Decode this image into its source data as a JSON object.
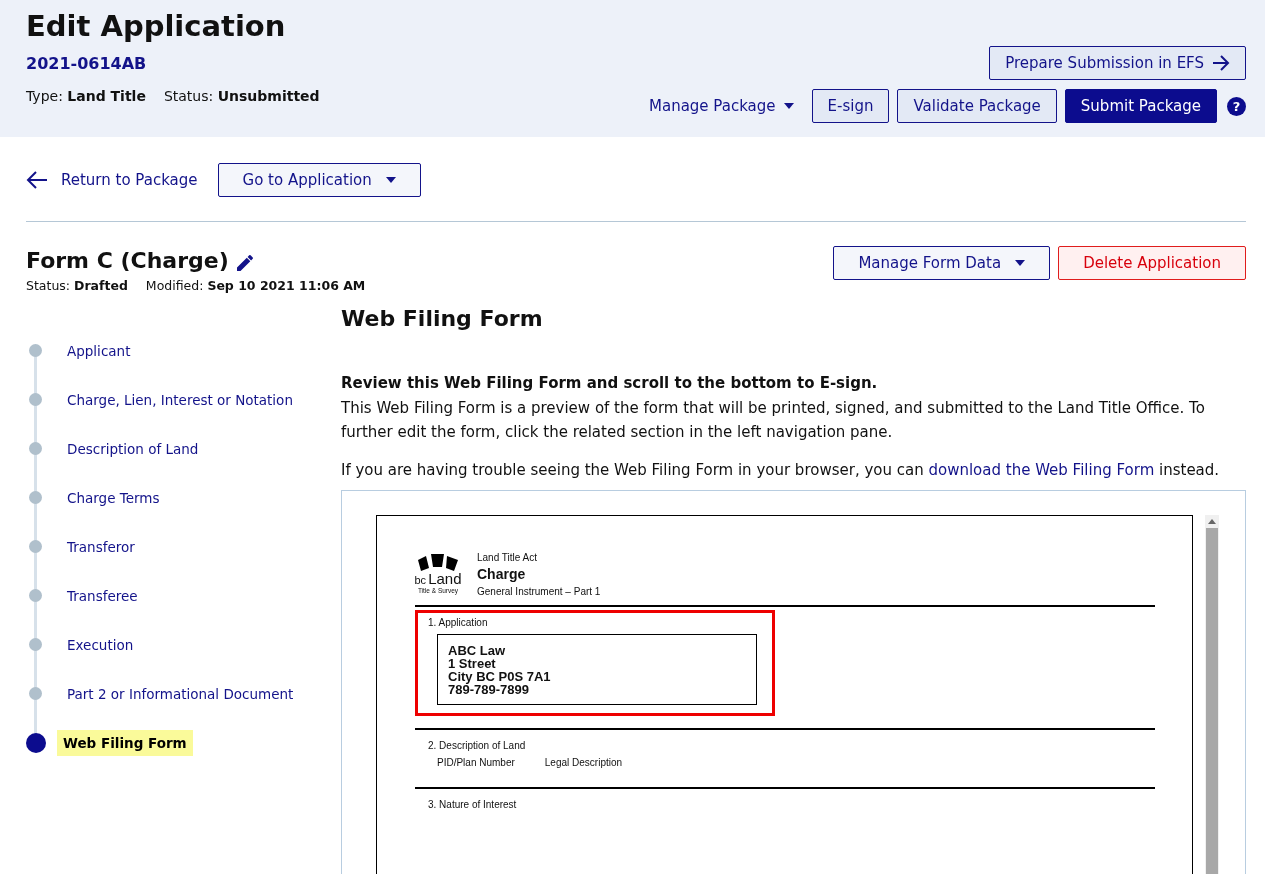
{
  "header": {
    "title": "Edit Application",
    "reference": "2021-0614AB",
    "meta": [
      {
        "label": "Type:",
        "value": "Land Title"
      },
      {
        "label": "Status:",
        "value": "Unsubmitted"
      }
    ],
    "top_button": {
      "label": "Prepare Submission in EFS"
    },
    "actions": [
      {
        "kind": "menu",
        "label": "Manage Package"
      },
      {
        "kind": "outline",
        "label": "E-sign"
      },
      {
        "kind": "outline",
        "label": "Validate Package"
      },
      {
        "kind": "primary",
        "label": "Submit Package"
      },
      {
        "kind": "help",
        "label": "?"
      }
    ]
  },
  "nav": {
    "back": "Return to Package",
    "dropdown": "Go to Application"
  },
  "form": {
    "title": "Form C (Charge)",
    "meta": [
      {
        "label": "Status:",
        "value": "Drafted"
      },
      {
        "label": "Modified:",
        "value": "Sep 10 2021 11:06 AM"
      }
    ],
    "buttons": [
      {
        "kind": "menu",
        "label": "Manage Form Data"
      },
      {
        "kind": "danger",
        "label": "Delete Application"
      }
    ]
  },
  "steps": [
    {
      "label": "Applicant",
      "selected": false
    },
    {
      "label": "Charge, Lien, Interest or Notation",
      "selected": false
    },
    {
      "label": "Description of Land",
      "selected": false
    },
    {
      "label": "Charge Terms",
      "selected": false
    },
    {
      "label": "Transferor",
      "selected": false
    },
    {
      "label": "Transferee",
      "selected": false
    },
    {
      "label": "Execution",
      "selected": false
    },
    {
      "label": "Part 2 or Informational Document",
      "selected": false
    },
    {
      "label": "Web Filing Form",
      "selected": true
    }
  ],
  "content": {
    "heading": "Web Filing Form",
    "intro_bold": "Review this Web Filing Form and scroll to the bottom to E-sign.",
    "intro": "This Web Filing Form is a preview of the form that will be printed, signed, and submitted to the Land Title Office. To further edit the form, click the related section in the left navigation pane.",
    "help_before": "If you are having trouble seeing the Web Filing Form in your browser, you can ",
    "help_link": "download the Web Filing Form",
    "help_after": " instead."
  },
  "document": {
    "logo": {
      "small": "bc",
      "big": "Land",
      "sub": "Title & Survey"
    },
    "act": "Land Title Act",
    "title": "Charge",
    "subtitle": "General Instrument – Part 1",
    "sections": [
      {
        "kind": "address",
        "title": "1. Application",
        "highlighted": true,
        "lines": [
          "ABC Law",
          "1 Street",
          "City BC P0S 7A1",
          "789-789-7899"
        ]
      },
      {
        "kind": "columns",
        "title": "2. Description of Land",
        "highlighted": false,
        "columns": [
          "PID/Plan Number",
          "Legal Description"
        ]
      },
      {
        "kind": "plain",
        "title": "3. Nature of Interest",
        "highlighted": false
      }
    ]
  }
}
